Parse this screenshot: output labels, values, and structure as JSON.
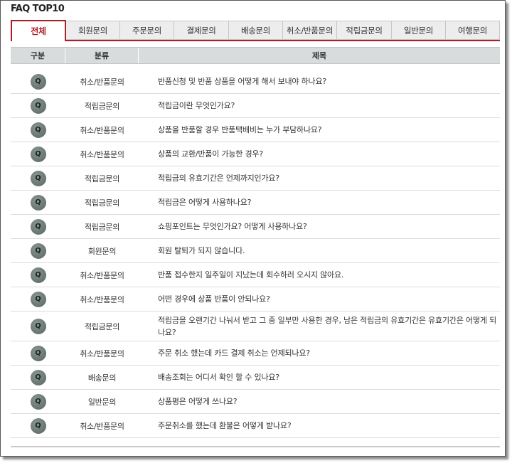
{
  "title": "FAQ TOP10",
  "tabs": [
    {
      "label": "전체",
      "active": true
    },
    {
      "label": "회원문의"
    },
    {
      "label": "주문문의"
    },
    {
      "label": "결제문의"
    },
    {
      "label": "배송문의"
    },
    {
      "label": "취소/반품문의"
    },
    {
      "label": "적립금문의"
    },
    {
      "label": "일반문의"
    },
    {
      "label": "여행문의"
    }
  ],
  "header": {
    "col1": "구분",
    "col2": "분류",
    "col3": "제목"
  },
  "badge_label": "Q",
  "rows": [
    {
      "category": "취소/반품문의",
      "title": "반품신청 및 반품 상품을 어떻게 해서 보내야 하나요?"
    },
    {
      "category": "적립금문의",
      "title": "적립금이란 무엇인가요?"
    },
    {
      "category": "취소/반품문의",
      "title": "상품을 반품할 경우 반품택배비는 누가 부담하나요?"
    },
    {
      "category": "취소/반품문의",
      "title": "상품의 교환/반품이 가능한 경우?"
    },
    {
      "category": "적립금문의",
      "title": "적립금의 유효기간은 언제까지인가요?"
    },
    {
      "category": "적립금문의",
      "title": "적립금은 어떻게 사용하나요?"
    },
    {
      "category": "적립금문의",
      "title": "쇼핑포인트는 무엇인가요? 어떻게 사용하나요?"
    },
    {
      "category": "회원문의",
      "title": "회원 탈퇴가 되지 않습니다."
    },
    {
      "category": "취소/반품문의",
      "title": "반품 접수한지 일주일이 지났는데 회수하러 오시지 않아요."
    },
    {
      "category": "취소/반품문의",
      "title": "어떤 경우에 상품 반품이 안되나요?"
    },
    {
      "category": "적립금문의",
      "title": "적립금을 오랜기간 나눠서 받고 그 중 일부만 사용한 경우, 남은 적립금의 유효기간은 유효기간은 어떻게 되나요?"
    },
    {
      "category": "취소/반품문의",
      "title": "주문 취소 했는데 카드 결제 취소는 언제되나요?"
    },
    {
      "category": "배송문의",
      "title": "배송조회는 어디서 확인 할 수 있나요?"
    },
    {
      "category": "일반문의",
      "title": "상품평은 어떻게 쓰나요?"
    },
    {
      "category": "취소/반품문의",
      "title": "주문취소를 했는데 환불은 어떻게 받나요?"
    }
  ],
  "colors": {
    "accent": "#ad1e28",
    "header_bg": "#d9dcdc",
    "tab_bg": "#ededed",
    "badge": "#6f7e79"
  }
}
